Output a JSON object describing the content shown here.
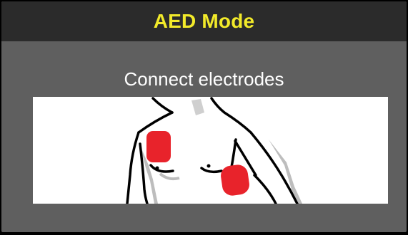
{
  "header": {
    "title": "AED Mode"
  },
  "instruction": {
    "text": "Connect electrodes"
  },
  "illustration": {
    "subject": "torso-outline",
    "electrode_color": "#e8232b",
    "monitor_patch_color": "#cfcfcf"
  },
  "colors": {
    "header_background": "#2b2b2b",
    "title_text": "#f2ea2a",
    "screen_background": "#5f5f5f",
    "instruction_text": "#ffffff"
  }
}
